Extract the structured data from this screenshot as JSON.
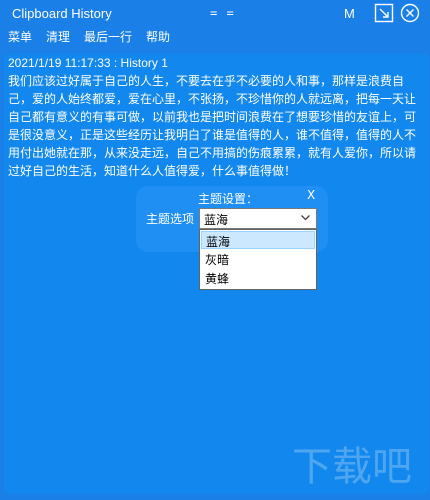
{
  "window": {
    "title": "Clipboard History",
    "drag_glyph": "= =",
    "m_label": "M"
  },
  "menu": {
    "items": [
      "菜单",
      "清理",
      "最后一行",
      "帮助"
    ]
  },
  "entry": {
    "header": "2021/1/19 11:17:33 : History 1",
    "text": "我们应该过好属于自己的人生，不要去在乎不必要的人和事，那样是浪费自己，爱的人始终都爱，爱在心里，不张扬，不珍惜你的人就远离，把每一天让自己都有意义的有事可做，以前我也是把时间浪费在了想要珍惜的友谊上，可是很没意义，正是这些经历让我明白了谁是值得的人，谁不值得，值得的人不用付出她就在那，从来没走远，自己不用搞的伤痕累累，就有人爱你，所以请过好自己的生活，知道什么人值得爱，什么事值得做！"
  },
  "theme_panel": {
    "title": "主题设置：",
    "close_label": "X",
    "label": "主题选项",
    "selected": "蓝海",
    "options": [
      "蓝海",
      "灰暗",
      "黄蜂"
    ]
  },
  "watermark": {
    "text": "下载吧"
  },
  "icons": {
    "restore": "restore-icon",
    "close": "close-circle-icon",
    "chevron": "chevron-down-icon"
  },
  "colors": {
    "background": "#1a7fe6",
    "content": "#1288ee",
    "panel": "#208ff4",
    "selected_option": "#cce8ff"
  }
}
